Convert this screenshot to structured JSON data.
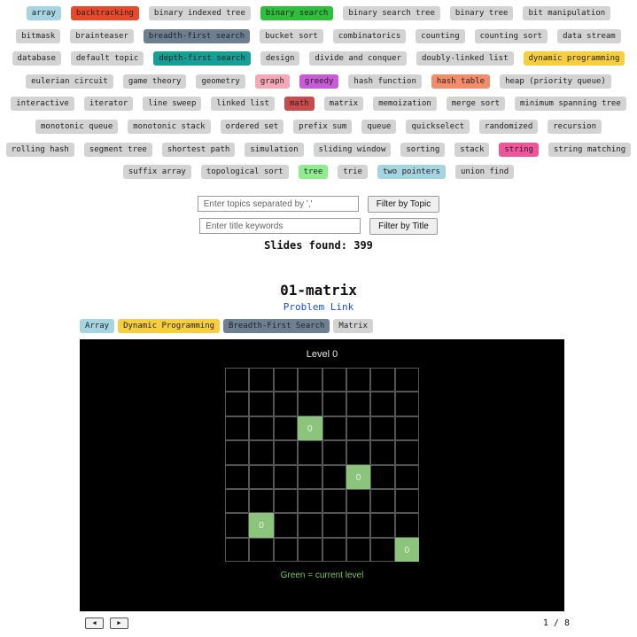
{
  "topic_tags": [
    [
      {
        "label": "array",
        "color": "#a6d4e0"
      },
      {
        "label": "backtracking",
        "color": "#e8492b"
      },
      {
        "label": "binary indexed tree",
        "color": "#d3d3d3"
      },
      {
        "label": "binary search",
        "color": "#2fbf3a"
      },
      {
        "label": "binary search tree",
        "color": "#d3d3d3"
      },
      {
        "label": "binary tree",
        "color": "#d3d3d3"
      },
      {
        "label": "bit manipulation",
        "color": "#d3d3d3"
      }
    ],
    [
      {
        "label": "bitmask",
        "color": "#d3d3d3"
      },
      {
        "label": "brainteaser",
        "color": "#d3d3d3"
      },
      {
        "label": "breadth-first search",
        "color": "#6e7f92"
      },
      {
        "label": "bucket sort",
        "color": "#d3d3d3"
      },
      {
        "label": "combinatorics",
        "color": "#d3d3d3"
      },
      {
        "label": "counting",
        "color": "#d3d3d3"
      },
      {
        "label": "counting sort",
        "color": "#d3d3d3"
      },
      {
        "label": "data stream",
        "color": "#d3d3d3"
      }
    ],
    [
      {
        "label": "database",
        "color": "#d3d3d3"
      },
      {
        "label": "default topic",
        "color": "#d3d3d3"
      },
      {
        "label": "depth-first search",
        "color": "#169f96"
      },
      {
        "label": "design",
        "color": "#d3d3d3"
      },
      {
        "label": "divide and conquer",
        "color": "#d3d3d3"
      },
      {
        "label": "doubly-linked list",
        "color": "#d3d3d3"
      },
      {
        "label": "dynamic programming",
        "color": "#f7cf3e"
      }
    ],
    [
      {
        "label": "eulerian circuit",
        "color": "#d3d3d3"
      },
      {
        "label": "game theory",
        "color": "#d3d3d3"
      },
      {
        "label": "geometry",
        "color": "#d3d3d3"
      },
      {
        "label": "graph",
        "color": "#f5a8b6"
      },
      {
        "label": "greedy",
        "color": "#c95ad8"
      },
      {
        "label": "hash function",
        "color": "#d3d3d3"
      },
      {
        "label": "hash table",
        "color": "#f28c6b"
      },
      {
        "label": "heap (priority queue)",
        "color": "#d3d3d3"
      }
    ],
    [
      {
        "label": "interactive",
        "color": "#d3d3d3"
      },
      {
        "label": "iterator",
        "color": "#d3d3d3"
      },
      {
        "label": "line sweep",
        "color": "#d3d3d3"
      },
      {
        "label": "linked list",
        "color": "#d3d3d3"
      },
      {
        "label": "math",
        "color": "#c94b4b"
      },
      {
        "label": "matrix",
        "color": "#d3d3d3"
      },
      {
        "label": "memoization",
        "color": "#d3d3d3"
      },
      {
        "label": "merge sort",
        "color": "#d3d3d3"
      },
      {
        "label": "minimum spanning tree",
        "color": "#d3d3d3"
      }
    ],
    [
      {
        "label": "monotonic queue",
        "color": "#d3d3d3"
      },
      {
        "label": "monotonic stack",
        "color": "#d3d3d3"
      },
      {
        "label": "ordered set",
        "color": "#d3d3d3"
      },
      {
        "label": "prefix sum",
        "color": "#d3d3d3"
      },
      {
        "label": "queue",
        "color": "#d3d3d3"
      },
      {
        "label": "quickselect",
        "color": "#d3d3d3"
      },
      {
        "label": "randomized",
        "color": "#d3d3d3"
      },
      {
        "label": "recursion",
        "color": "#d3d3d3"
      }
    ],
    [
      {
        "label": "rolling hash",
        "color": "#d3d3d3"
      },
      {
        "label": "segment tree",
        "color": "#d3d3d3"
      },
      {
        "label": "shortest path",
        "color": "#d3d3d3"
      },
      {
        "label": "simulation",
        "color": "#d3d3d3"
      },
      {
        "label": "sliding window",
        "color": "#d3d3d3"
      },
      {
        "label": "sorting",
        "color": "#d3d3d3"
      },
      {
        "label": "stack",
        "color": "#d3d3d3"
      },
      {
        "label": "string",
        "color": "#f0559b"
      },
      {
        "label": "string matching",
        "color": "#d3d3d3"
      }
    ],
    [
      {
        "label": "suffix array",
        "color": "#d3d3d3"
      },
      {
        "label": "topological sort",
        "color": "#d3d3d3"
      },
      {
        "label": "tree",
        "color": "#8fed8f"
      },
      {
        "label": "trie",
        "color": "#d3d3d3"
      },
      {
        "label": "two pointers",
        "color": "#a6d4e0"
      },
      {
        "label": "union find",
        "color": "#d3d3d3"
      }
    ]
  ],
  "filters": {
    "topic_placeholder": "Enter topics separated by ','",
    "topic_button": "Filter by Topic",
    "title_placeholder": "Enter title keywords",
    "title_button": "Filter by Title"
  },
  "slides_found": "Slides found: 399",
  "slide": {
    "title": "01-matrix",
    "link_text": "Problem Link",
    "tags": [
      {
        "label": "Array",
        "color": "#a6d4e0"
      },
      {
        "label": "Dynamic Programming",
        "color": "#f7cf3e"
      },
      {
        "label": "Breadth-First Search",
        "color": "#6e7f92"
      },
      {
        "label": "Matrix",
        "color": "#d3d3d3"
      }
    ],
    "visual": {
      "level_title": "Level 0",
      "rows": 8,
      "cols": 8,
      "active_color": "#8bc47a",
      "active_cells": [
        {
          "row": 2,
          "col": 3,
          "value": "0"
        },
        {
          "row": 4,
          "col": 5,
          "value": "0"
        },
        {
          "row": 6,
          "col": 1,
          "value": "0"
        },
        {
          "row": 7,
          "col": 7,
          "value": "0"
        }
      ],
      "legend": "Green = current level"
    }
  },
  "navigation": {
    "prev_icon": "◀",
    "next_icon": "▶",
    "page_indicator": "1 / 8"
  }
}
